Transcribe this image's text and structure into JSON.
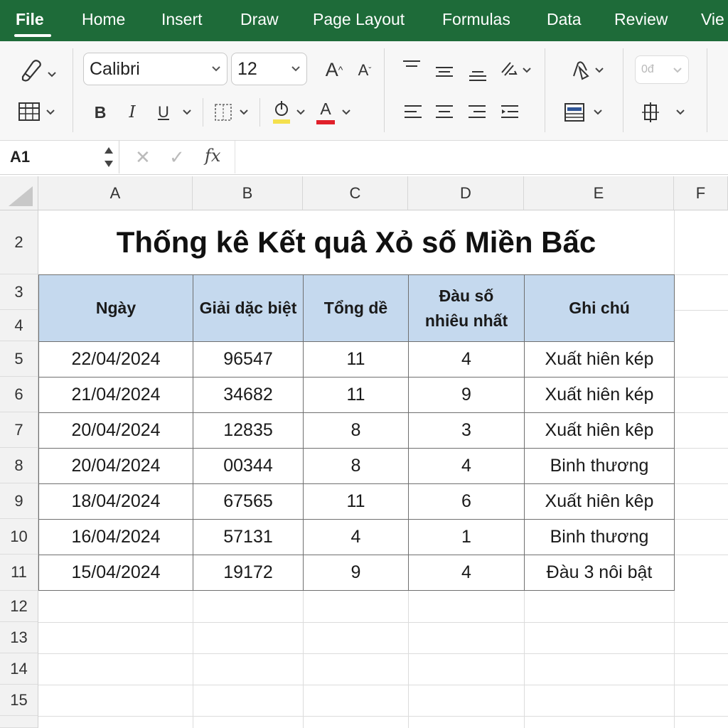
{
  "menu": {
    "tabs": [
      {
        "label": "File",
        "active": true
      },
      {
        "label": "Home"
      },
      {
        "label": "Insert"
      },
      {
        "label": "Draw"
      },
      {
        "label": "Page Layout"
      },
      {
        "label": "Formulas"
      },
      {
        "label": "Data"
      },
      {
        "label": "Review"
      },
      {
        "label": "Vie"
      }
    ]
  },
  "ribbon": {
    "font_name": "Calibri",
    "font_size": "12",
    "increase_font_label": "A",
    "decrease_font_label": "A",
    "bold_label": "B",
    "italic_label": "I",
    "underline_label": "U",
    "font_color_label": "A",
    "number_format_label": "0đ",
    "highlight_color": "#f4e04d",
    "font_color": "#e0202a"
  },
  "formula_bar": {
    "name_box": "A1",
    "fx_label": "fx",
    "formula": ""
  },
  "grid": {
    "columns": [
      "A",
      "B",
      "C",
      "D",
      "E",
      "F"
    ],
    "rows": [
      "2",
      "3",
      "4",
      "5",
      "6",
      "7",
      "8",
      "9",
      "10",
      "11",
      "12",
      "13",
      "14",
      "15"
    ]
  },
  "sheet": {
    "title": "Thống kê Kết quâ Xỏ số Miền Bấc",
    "headers": [
      "Ngày",
      "Giải dặc biệt",
      "Tổng dề",
      "Đàu số\nnhiêu nhất",
      "Ghi chú"
    ],
    "rows": [
      [
        "22/04/2024",
        "96547",
        "11",
        "4",
        "Xuất hiên kép"
      ],
      [
        "21/04/2024",
        "34682",
        "11",
        "9",
        "Xuất hiên kép"
      ],
      [
        "20/04/2024",
        "12835",
        "8",
        "3",
        "Xuất hiên kêp"
      ],
      [
        "20/04/2024",
        "00344",
        "8",
        "4",
        "Binh thương"
      ],
      [
        "18/04/2024",
        "67565",
        "11",
        "6",
        "Xuất hiên kêp"
      ],
      [
        "16/04/2024",
        "57131",
        "4",
        "1",
        "Binh thương"
      ],
      [
        "15/04/2024",
        "19172",
        "9",
        "4",
        "Đàu 3 nôi bật"
      ]
    ],
    "header_fill": "#c5d9ee"
  }
}
